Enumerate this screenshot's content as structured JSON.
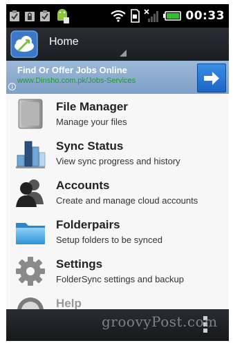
{
  "status_bar": {
    "icons": [
      "clipboard-check-icon",
      "lock-icon",
      "clipboard-check-icon",
      "android-icon",
      "wifi-icon",
      "sd-card-icon",
      "no-signal-icon",
      "battery-icon"
    ],
    "time": "00:33"
  },
  "action_bar": {
    "title": "Home",
    "app_icon": "cloud-sync-icon"
  },
  "ad_banner": {
    "title": "Find Or Offer Jobs Online",
    "url": "www.Dinsho.com.pk/Jobs-Services",
    "info_icon": "info-icon",
    "arrow_icon": "arrow-right-icon"
  },
  "menu": [
    {
      "title": "File Manager",
      "subtitle": "Manage your files",
      "icon": "file-cabinet-icon"
    },
    {
      "title": "Sync Status",
      "subtitle": "View sync progress and history",
      "icon": "bar-chart-icon"
    },
    {
      "title": "Accounts",
      "subtitle": "Create and manage cloud accounts",
      "icon": "users-icon"
    },
    {
      "title": "Folderpairs",
      "subtitle": "Setup folders to be synced",
      "icon": "folder-icon"
    },
    {
      "title": "Settings",
      "subtitle": "FolderSync settings and backup",
      "icon": "gear-icon"
    },
    {
      "title": "Help",
      "subtitle": "",
      "icon": "help-icon"
    }
  ],
  "watermark": "groovyPost.com",
  "colors": {
    "action_bar": "#23272c",
    "ad_background": "#8fb0d2",
    "ad_url": "#1f9a2a",
    "ad_button": "#2b7bd8",
    "list_background": "#f6f6f6"
  }
}
